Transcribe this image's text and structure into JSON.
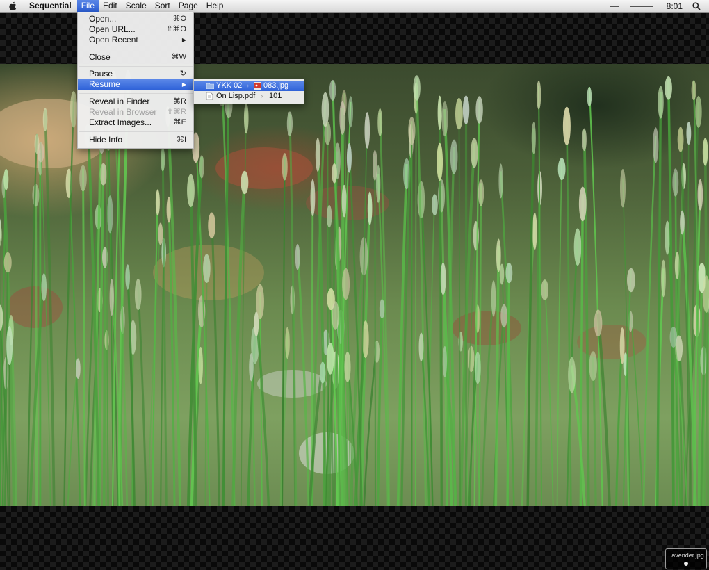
{
  "menubar": {
    "app_name": "Sequential",
    "menus": [
      "File",
      "Edit",
      "Scale",
      "Sort",
      "Page",
      "Help"
    ],
    "clock": "8:01",
    "icons": [
      "apple-icon",
      "minimize-icon",
      "spotlight-icon"
    ]
  },
  "file_menu": {
    "items": [
      {
        "label": "Open...",
        "shortcut": "⌘O"
      },
      {
        "label": "Open URL...",
        "shortcut": "⇧⌘O"
      },
      {
        "label": "Open Recent",
        "shortcut": "▶"
      },
      {
        "label": "Close",
        "shortcut": "⌘W"
      },
      {
        "label": "Pause",
        "shortcut": "↻"
      },
      {
        "label": "Resume",
        "shortcut": "▶"
      },
      {
        "label": "Reveal in Finder",
        "shortcut": "⌘R"
      },
      {
        "label": "Reveal in Browser",
        "shortcut": "⇧⌘R"
      },
      {
        "label": "Extract Images...",
        "shortcut": "⌘E"
      },
      {
        "label": "Hide Info",
        "shortcut": "⌘I"
      }
    ]
  },
  "resume_submenu": {
    "items": [
      {
        "folder": "YKK 02",
        "file": "083.jpg",
        "icon": "folder-icon",
        "file_icon": "image-file-icon"
      },
      {
        "folder": "On Lisp.pdf",
        "file": "101",
        "icon": "pdf-icon"
      }
    ],
    "separator": "›"
  },
  "info_badge": {
    "filename": "Lavender.jpg",
    "position_fraction": 0.5
  },
  "colors": {
    "highlight": "#2f62d8",
    "menu_bg": "#f0f0f0",
    "backdrop": "#0b0b0b"
  }
}
